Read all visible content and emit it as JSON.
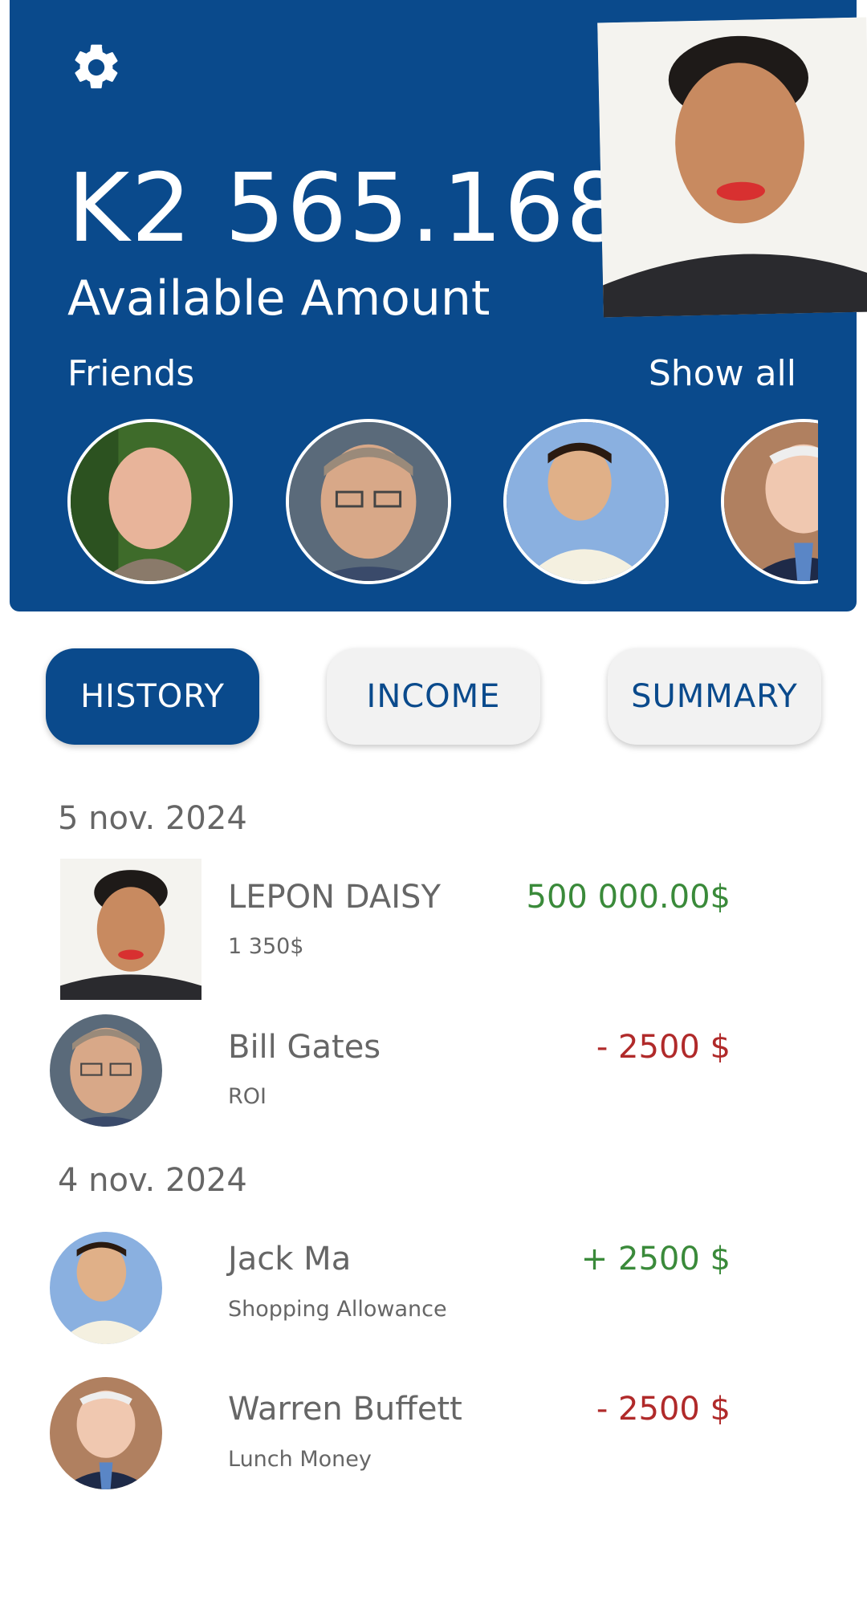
{
  "header": {
    "balance": "K2 565.168",
    "balance_label": "Available Amount",
    "friends_title": "Friends",
    "show_all": "Show all"
  },
  "tabs": [
    {
      "label": "HISTORY",
      "active": true
    },
    {
      "label": "INCOME",
      "active": false
    },
    {
      "label": "SUMMARY",
      "active": false
    }
  ],
  "history": {
    "groups": [
      {
        "date": "5 nov. 2024",
        "items": [
          {
            "name": "LEPON DAISY",
            "note": "1 350$",
            "amount": "500 000.00$",
            "direction": "in"
          },
          {
            "name": "Bill Gates",
            "note": "ROI",
            "amount": "- 2500 $",
            "direction": "out"
          }
        ]
      },
      {
        "date": "4 nov. 2024",
        "items": [
          {
            "name": "Jack Ma",
            "note": "Shopping Allowance",
            "amount": "+ 2500 $",
            "direction": "in"
          },
          {
            "name": "Warren Buffett",
            "note": "Lunch Money",
            "amount": "- 2500 $",
            "direction": "out"
          }
        ]
      }
    ]
  },
  "colors": {
    "brand_blue": "#0a4a8c",
    "income_green": "#3a8a3a",
    "expense_red": "#b02a2a"
  }
}
